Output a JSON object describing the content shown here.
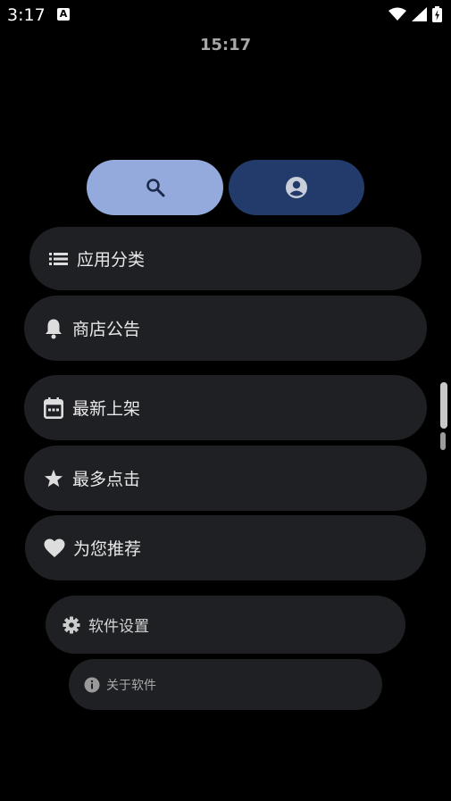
{
  "status_bar": {
    "time": "3:17",
    "notification_icon": "a-badge-icon",
    "icons": [
      "wifi-icon",
      "signal-icon",
      "battery-charging-icon"
    ]
  },
  "clock": "15:17",
  "top_buttons": [
    {
      "name": "search",
      "icon": "search-icon"
    },
    {
      "name": "profile",
      "icon": "account-circle-icon"
    }
  ],
  "menu": {
    "categories": "应用分类",
    "announcements": "商店公告",
    "new_arrivals": "最新上架",
    "most_clicked": "最多点击",
    "recommended": "为您推荐",
    "settings": "软件设置",
    "about": "关于软件"
  },
  "colors": {
    "background": "#000000",
    "search_button": "#94a9dc",
    "profile_button": "#223b6b",
    "menu_item": "#1f2024"
  }
}
